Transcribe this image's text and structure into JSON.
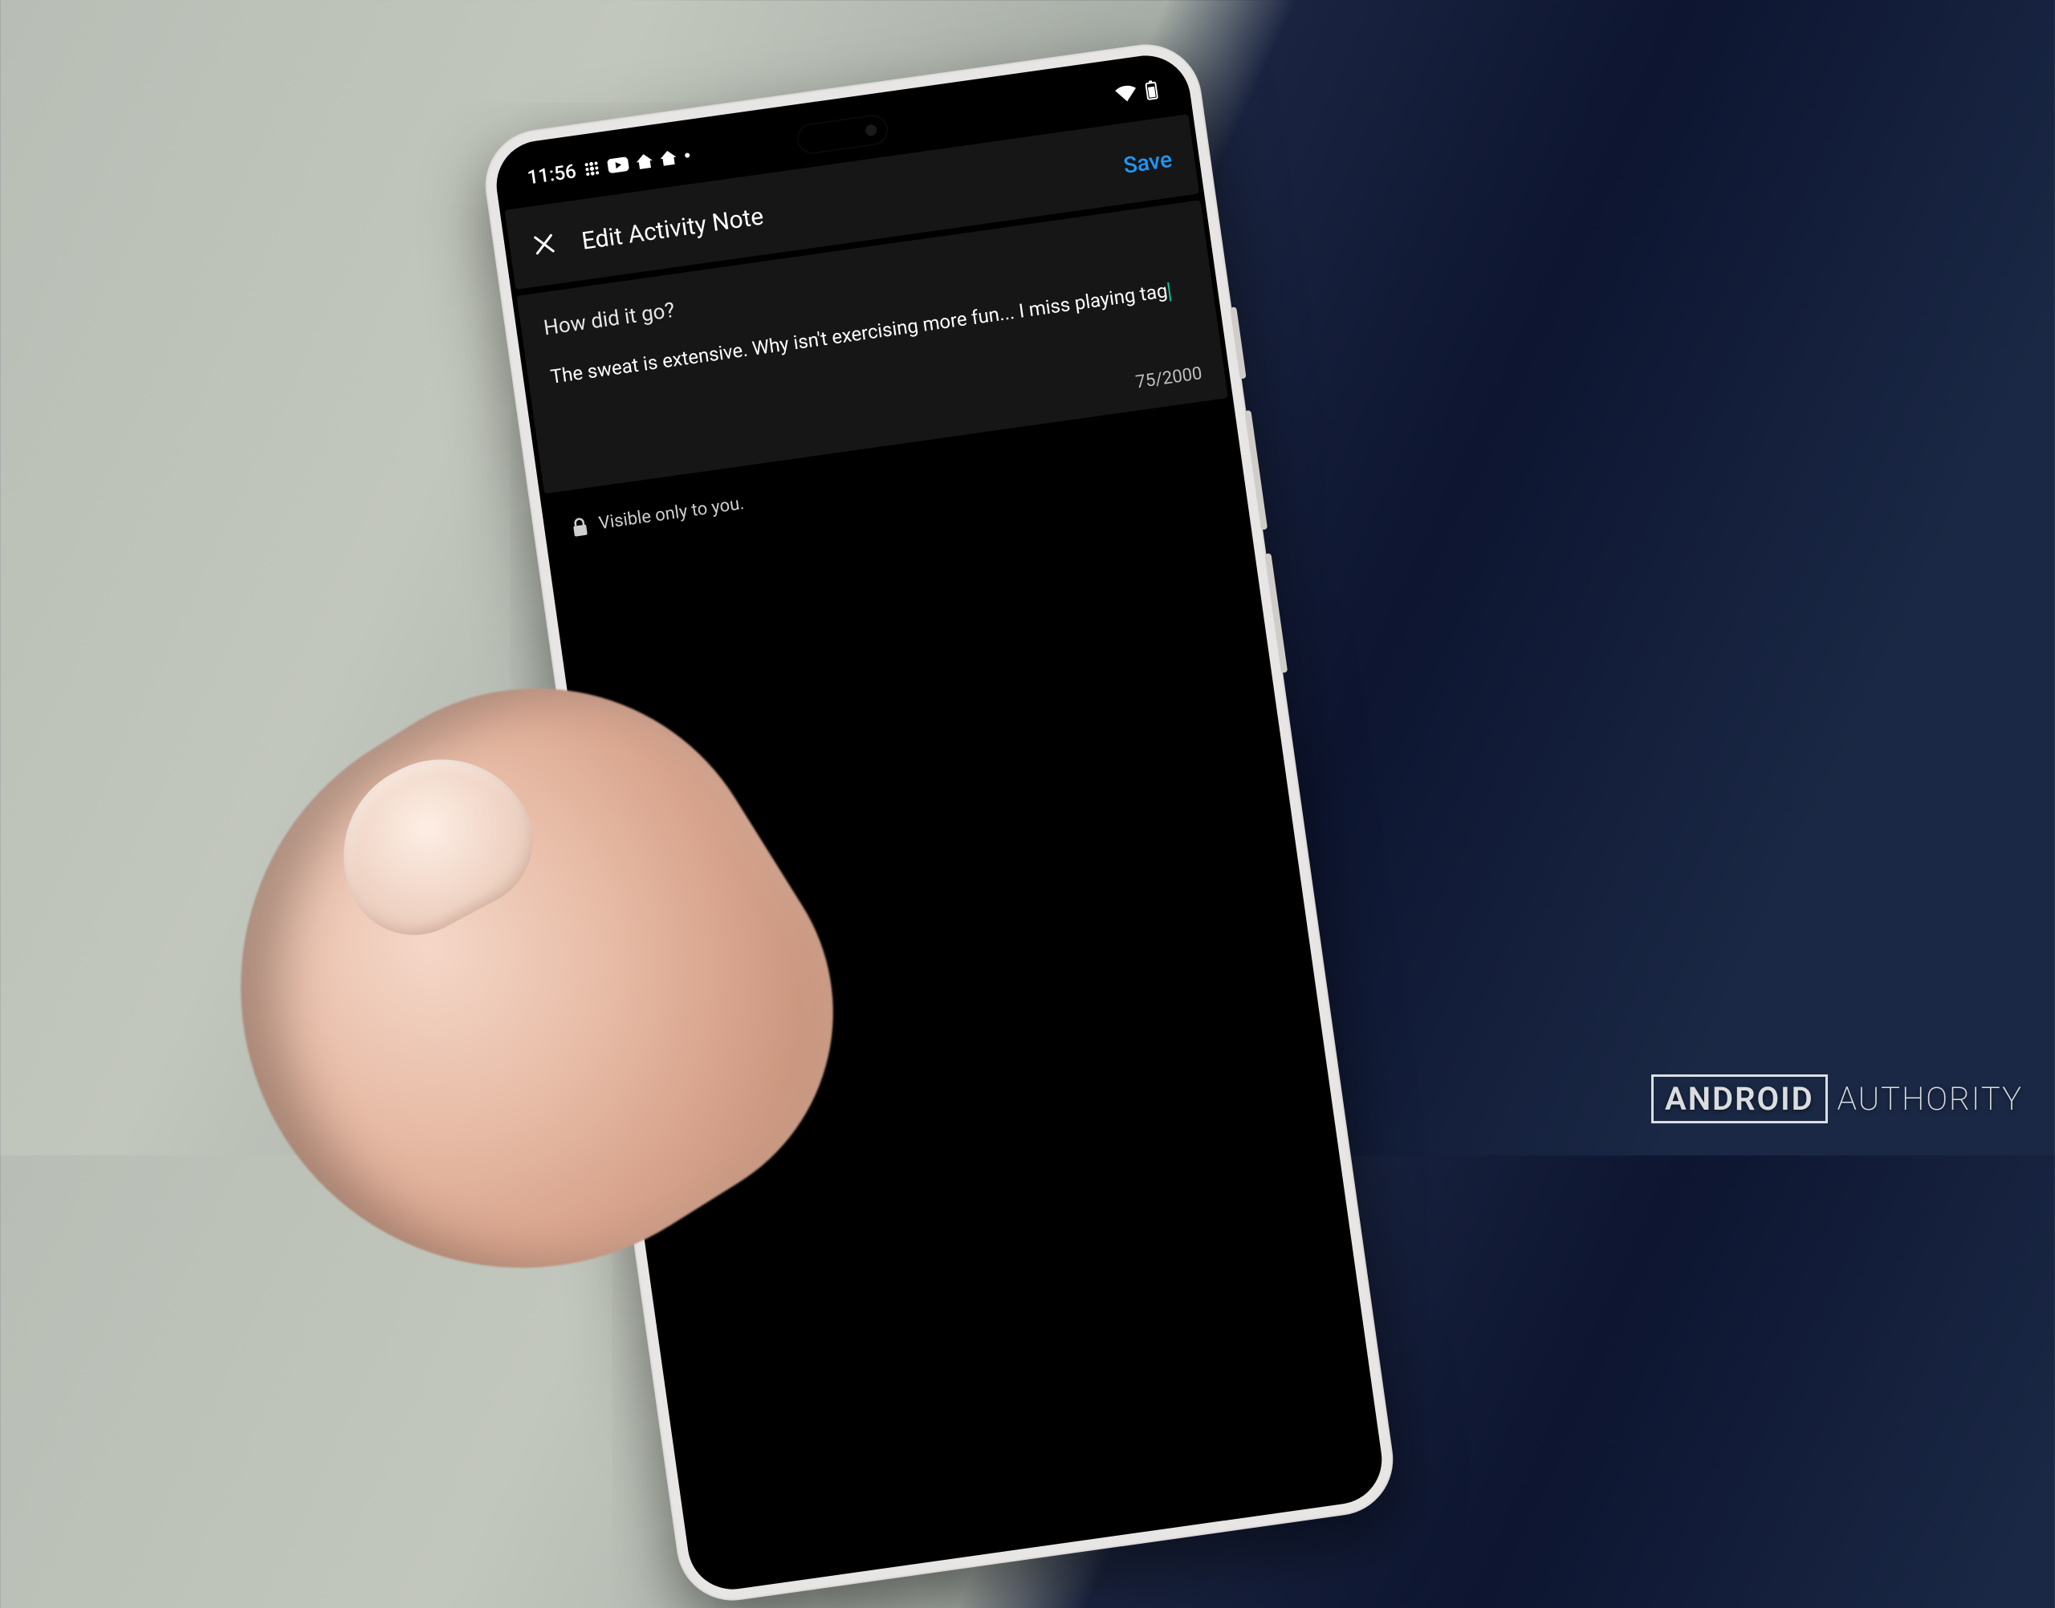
{
  "status_bar": {
    "time": "11:56",
    "icons": [
      "fitbit",
      "youtube",
      "home",
      "home2",
      "dot"
    ],
    "right_icons": [
      "wifi",
      "battery"
    ]
  },
  "header": {
    "title": "Edit Activity Note",
    "save_label": "Save"
  },
  "note": {
    "prompt": "How did it go?",
    "body": "The sweat is extensive. Why isn't exercising more fun... I miss playing tag",
    "counter": "75/2000"
  },
  "privacy": {
    "label": "Visible only to you."
  },
  "watermark": {
    "word1": "ANDROID",
    "word2": "AUTHORITY"
  }
}
